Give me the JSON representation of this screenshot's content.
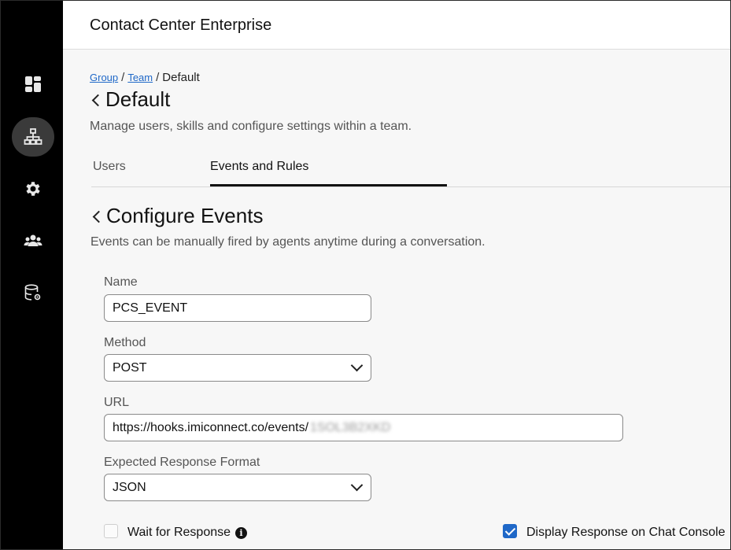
{
  "app": {
    "title": "Contact Center Enterprise"
  },
  "sidebar": {
    "items": [
      {
        "icon": "dashboard-icon",
        "active": false
      },
      {
        "icon": "org-hierarchy-icon",
        "active": true
      },
      {
        "icon": "gear-icon",
        "active": false
      },
      {
        "icon": "team-icon",
        "active": false
      },
      {
        "icon": "database-settings-icon",
        "active": false
      }
    ]
  },
  "breadcrumb": {
    "items": [
      "Group",
      "Team"
    ],
    "current": "Default",
    "separator": "/"
  },
  "page": {
    "title": "Default",
    "description": "Manage users, skills and configure settings within a team."
  },
  "tabs": [
    {
      "label": "Users",
      "active": false
    },
    {
      "label": "Events and Rules",
      "active": true
    }
  ],
  "section": {
    "title": "Configure Events",
    "description": "Events can be manually fired by agents anytime during a conversation."
  },
  "form": {
    "name": {
      "label": "Name",
      "value": "PCS_EVENT"
    },
    "method": {
      "label": "Method",
      "value": "POST"
    },
    "url": {
      "label": "URL",
      "value": "https://hooks.imiconnect.co/events/",
      "redacted": "1SOL3B2XKD"
    },
    "response_format": {
      "label": "Expected Response Format",
      "value": "JSON"
    },
    "wait_for_response": {
      "label": "Wait for Response",
      "checked": false
    },
    "display_response": {
      "label": "Display Response on Chat Console",
      "checked": true
    }
  },
  "colors": {
    "accent": "#1f68c8",
    "sidebar": "#000000",
    "active_nav": "#3a3a3a"
  }
}
